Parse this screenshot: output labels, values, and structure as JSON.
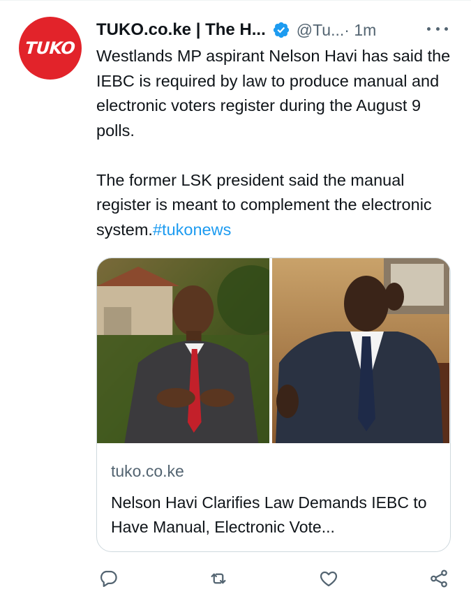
{
  "tweet": {
    "avatar_text": "TUKO",
    "author_name": "TUKO.co.ke | The H...",
    "handle": "@Tu...",
    "time": " · 1m",
    "paragraph_1": "Westlands MP aspirant Nelson Havi has said the IEBC is required by law to produce manual and electronic voters register during the August 9 polls.",
    "paragraph_2": "The former LSK president said the manual register is meant to complement the electronic system.",
    "hashtag": "#tukonews"
  },
  "card": {
    "domain": "tuko.co.ke",
    "title": "Nelson Havi Clarifies Law Demands IEBC to Have Manual, Electronic Vote..."
  },
  "icons": {
    "verified": "verified-badge-icon",
    "more": "more-options-icon",
    "reply": "reply-icon",
    "retweet": "retweet-icon",
    "like": "like-icon",
    "share": "share-icon"
  },
  "colors": {
    "brand": "#e2232a",
    "link": "#1d9bf0",
    "secondary_text": "#536471",
    "primary_text": "#0f1419",
    "border": "#cfd9de"
  }
}
